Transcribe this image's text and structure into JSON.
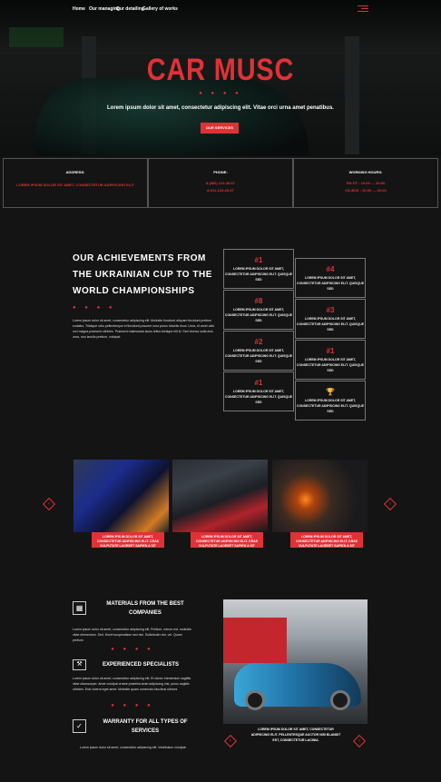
{
  "nav": {
    "items": [
      "Home",
      "Our managing",
      "Our detailing",
      "Gallery of works"
    ]
  },
  "hero": {
    "title": "CAR MUSC",
    "dots": "● ● ● ●",
    "subtitle": "Lorem ipsum dolor sit amet, consectetur adipiscing elit. Vitae orci urna amet penatibus.",
    "button": "OUR SERVICES"
  },
  "info": [
    {
      "heading": "ADDRESS:",
      "lines": [
        "LOREM IPSUM DOLOR SIT AMET, CONSECTETUR ADIPISCING ELIT"
      ]
    },
    {
      "heading": "PHONE:",
      "lines": [
        "8 (800) 123-45-67",
        "8-911-123-45-67"
      ]
    },
    {
      "heading": "WORKING HOURS:",
      "lines": [
        "ПН-ПТ : 10:00 — 20:00",
        "СБ-ВСК : 10:00 — 20:00"
      ]
    }
  ],
  "achievements": {
    "title": "OUR ACHIEVEMENTS FROM THE UKRAINIAN CUP TO THE WORLD CHAMPIONSHIPS",
    "dots": "● ● ● ●",
    "text": "Lorem ipsum dolor sit amet, consectetur adipiscing elit. Molestie tincidunt aliquam tincidunt pretium sodales. Tristique odio pellentesque et tincidunt posuere urna purus lobortis risus. Urna, et amet odio orci magna praesent ultricies. Praesent malesuada lacus tellus tristique elit id. Sed viverra nulla duis urna, non iaculis pretium, volutpat.",
    "card_text": "LOREM IPSUM DOLOR SIT AMET, CONSECTETUR ADIPISCING ELIT. QUISQUE SED",
    "cards": [
      {
        "num": "#1"
      },
      {
        "num": "#4"
      },
      {
        "num": "#8"
      },
      {
        "num": "#3"
      },
      {
        "num": "#2"
      },
      {
        "num": "#1"
      },
      {
        "num": "#1"
      },
      {
        "num": "🏆"
      }
    ]
  },
  "slider": {
    "prev": "‹",
    "next": "›",
    "caption": "LOREM IPSUM DOLOR SIT AMET, CONSECTETUR ADIPISCING ELIT. CRAS VULPUTATE LAOREET SAPIEN A SIT"
  },
  "features": [
    {
      "title": "MATERIALS FROM THE BEST COMPANIES",
      "text": "Lorem ipsum dolor sit amet, consectetur adipiscing elit. Pretium, rutrum est, molestie vitae elementum. Sed. Morbi suspendisse sed nisl. Sollicitudin nisi, vel. Quam pretium"
    },
    {
      "title": "EXPERIENCED SPECIALISTS",
      "text": "Lorem ipsum dolor sit amet, consectetur adipiscing elit. Et donec elementum sagittis vitae ullamcorper. Amet volutpat ornare pharetra amet adipiscing nisl, purus sagittis ultricies. Erat viverra eget amet. Molestie quam commodo faucibus ultrices"
    },
    {
      "title": "WARRANTY FOR ALL TYPES OF SERVICES",
      "text": "Lorem ipsum dolor sit amet, consectetur adipiscing elit. Vestibulum volutpat."
    }
  ],
  "feature_dots": "● ● ● ●",
  "feature_image": {
    "caption": "LOREM IPSUM DOLOR SIT AMET, CONSECTETUR ADIPISCING ELIT. PELLENTESQUE AUCTOR NISI BLANDIT EST, CONSECTETUR LACINIA.",
    "prev": "‹",
    "next": "›"
  },
  "colors": {
    "accent": "#e03236",
    "background": "#141414"
  }
}
